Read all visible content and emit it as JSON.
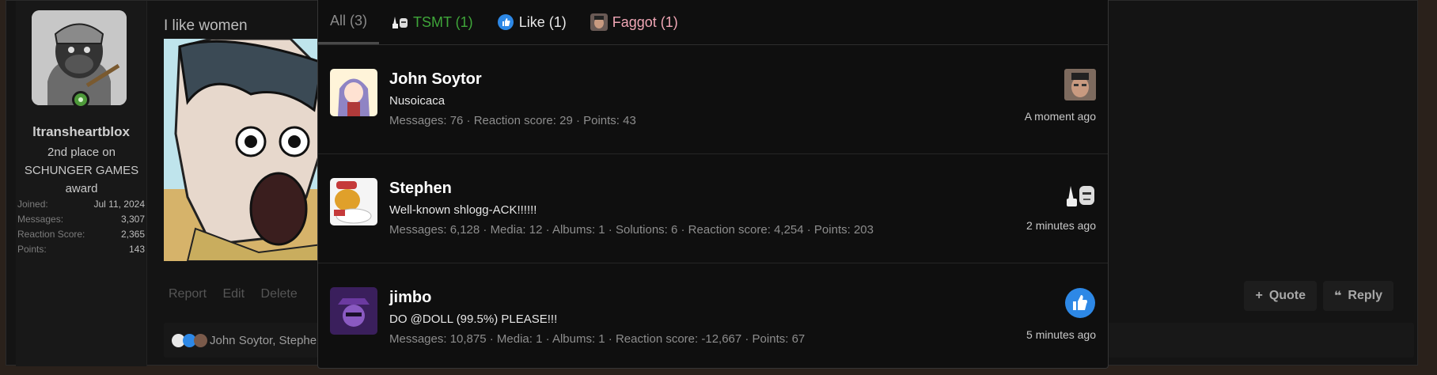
{
  "user": {
    "name": "ltransheartblox",
    "title": "2nd place on SCHUNGER GAMES award",
    "stats": [
      {
        "label": "Joined:",
        "value": "Jul 11, 2024"
      },
      {
        "label": "Messages:",
        "value": "3,307"
      },
      {
        "label": "Reaction Score:",
        "value": "2,365"
      },
      {
        "label": "Points:",
        "value": "143"
      }
    ]
  },
  "post": {
    "text": "I like women",
    "actions": [
      "Report",
      "Edit",
      "Delete"
    ],
    "quote_label": "Quote",
    "reply_label": "Reply",
    "reactions_summary": "John Soytor, Stephen"
  },
  "overlay": {
    "tabs": [
      {
        "label": "All (3)",
        "icon": ""
      },
      {
        "label": "TSMT (1)",
        "icon": "tsmt-reaction-icon"
      },
      {
        "label": "Like (1)",
        "icon": "like-icon"
      },
      {
        "label": "Faggot (1)",
        "icon": "face-reaction-icon"
      }
    ],
    "rows": [
      {
        "name": "John Soytor",
        "title": "Nusoicaca",
        "stats": "Messages: 76 · Reaction score: 29 · Points: 43",
        "time": "A moment ago",
        "reaction": "face-reaction-icon"
      },
      {
        "name": "Stephen",
        "title": "Well-known shlogg-ACK!!!!!!",
        "stats": "Messages: 6,128 · Media: 12 · Albums: 1 · Solutions: 6 · Reaction score: 4,254 · Points: 203",
        "time": "2 minutes ago",
        "reaction": "tsmt-reaction-icon"
      },
      {
        "name": "jimbo",
        "title": "DO @DOLL (99.5%) PLEASE!!!",
        "stats": "Messages: 10,875 · Media: 1 · Albums: 1 · Reaction score: -12,667 · Points: 67",
        "time": "5 minutes ago",
        "reaction": "like-icon"
      }
    ]
  },
  "colors": {
    "tsmt": "#3fa63a",
    "like": "#2d88e6",
    "faggot": "#f0a6b5"
  }
}
